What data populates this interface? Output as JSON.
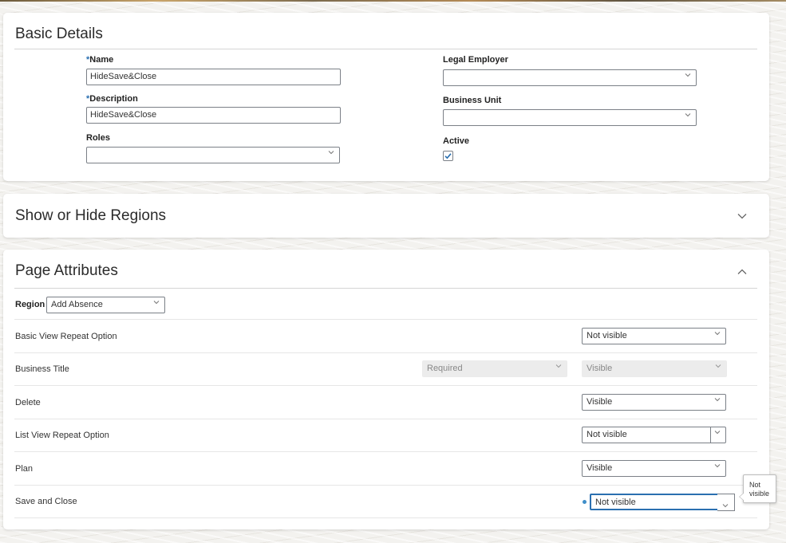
{
  "basic_details": {
    "title": "Basic Details",
    "name": {
      "label": "Name",
      "required_mark": "*",
      "value": "HideSave&Close"
    },
    "description": {
      "label": "Description",
      "required_mark": "*",
      "value": "HideSave&Close"
    },
    "roles": {
      "label": "Roles",
      "value": ""
    },
    "legal_employer": {
      "label": "Legal Employer",
      "value": ""
    },
    "business_unit": {
      "label": "Business Unit",
      "value": ""
    },
    "active": {
      "label": "Active",
      "checked": true
    }
  },
  "show_hide_regions": {
    "title": "Show or Hide Regions",
    "icon": "chevron-down-icon"
  },
  "page_attributes": {
    "title": "Page Attributes",
    "icon": "chevron-up-icon",
    "region": {
      "label": "Region",
      "value": "Add Absence"
    },
    "rows": [
      {
        "label": "Basic View Repeat Option",
        "visibility": "Not visible"
      },
      {
        "label": "Business Title",
        "requirement": "Required",
        "visibility": "Visible"
      },
      {
        "label": "Delete",
        "visibility": "Visible"
      },
      {
        "label": "List View Repeat Option",
        "visibility": "Not visible"
      },
      {
        "label": "Plan",
        "visibility": "Visible"
      },
      {
        "label": "Save and Close",
        "visibility": "Not visible"
      }
    ],
    "tooltip": "Not visible"
  },
  "colors": {
    "accent": "#2a6fb0",
    "dot": "#3f8ec9",
    "border": "#7b8087"
  }
}
